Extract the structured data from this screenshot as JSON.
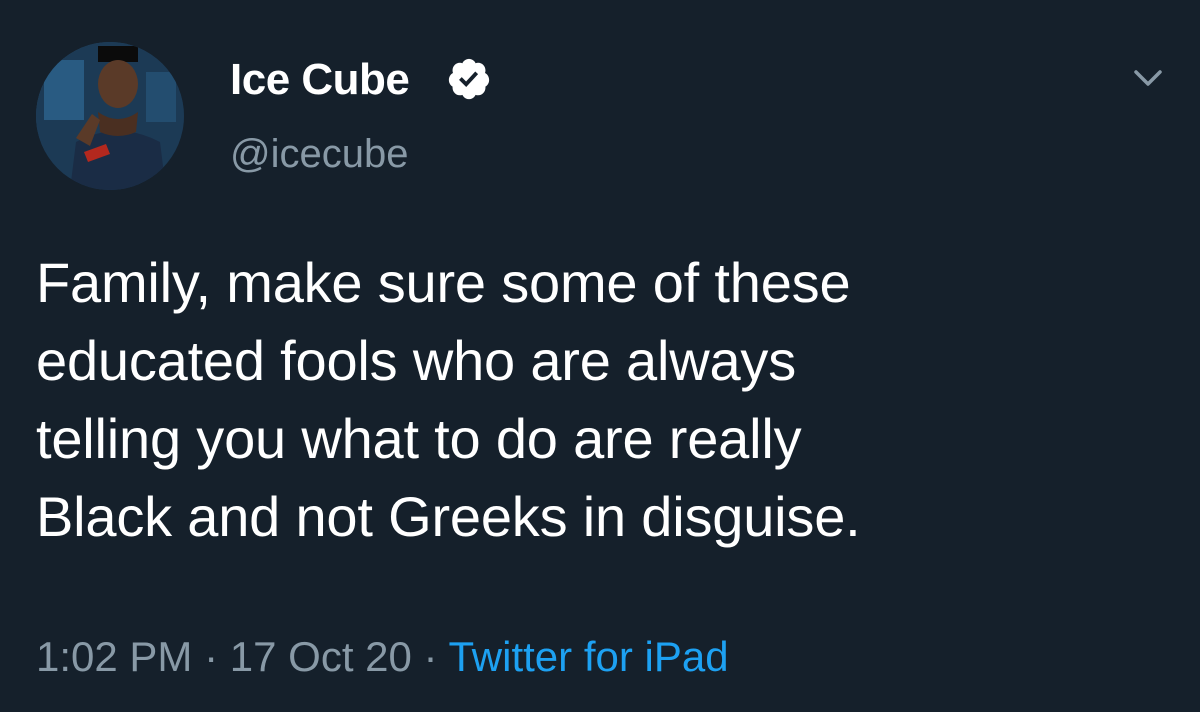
{
  "user": {
    "display_name": "Ice Cube",
    "handle": "@icecube",
    "verified": true
  },
  "tweet": {
    "text": "Family, make sure some of these\neducated fools who are always\ntelling you what to do are really\nBlack and not Greeks in disguise.",
    "time": "1:02 PM",
    "separator": "·",
    "date": "17 Oct 20",
    "source": "Twitter for iPad"
  },
  "colors": {
    "background": "#15202b",
    "text": "#ffffff",
    "secondary": "#8899a6",
    "accent": "#1da1f2"
  },
  "icons": {
    "verified": "verified-badge-icon",
    "menu": "chevron-down-icon"
  }
}
